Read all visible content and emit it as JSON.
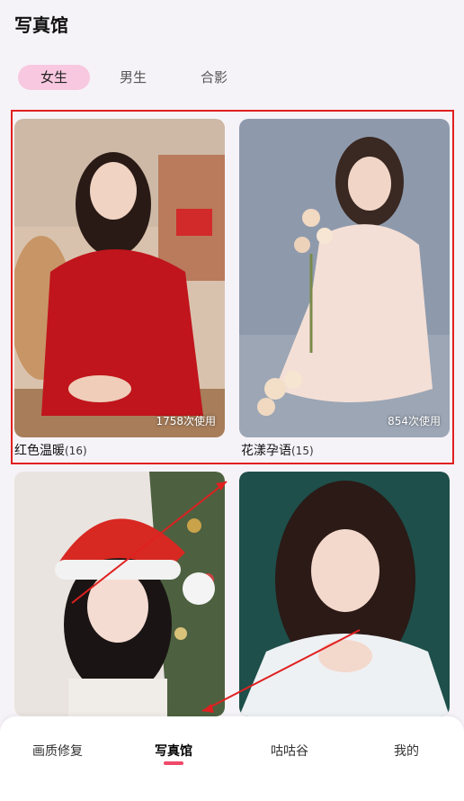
{
  "header": {
    "title": "写真馆"
  },
  "tabs": [
    {
      "label": "女生",
      "active": true
    },
    {
      "label": "男生",
      "active": false
    },
    {
      "label": "合影",
      "active": false
    }
  ],
  "cards": [
    {
      "title": "红色温暖",
      "count": "(16)",
      "usage": "1758次使用"
    },
    {
      "title": "花漾孕语",
      "count": "(15)",
      "usage": "854次使用"
    },
    {
      "title": "",
      "count": "",
      "usage": ""
    },
    {
      "title": "",
      "count": "",
      "usage": ""
    }
  ],
  "bottom_nav": [
    {
      "label": "画质修复"
    },
    {
      "label": "写真馆",
      "active": true
    },
    {
      "label": "咕咕谷"
    },
    {
      "label": "我的"
    }
  ],
  "colors": {
    "accent": "#f7c8df",
    "highlight_box": "#e02020",
    "indicator": "#f04a6a"
  }
}
